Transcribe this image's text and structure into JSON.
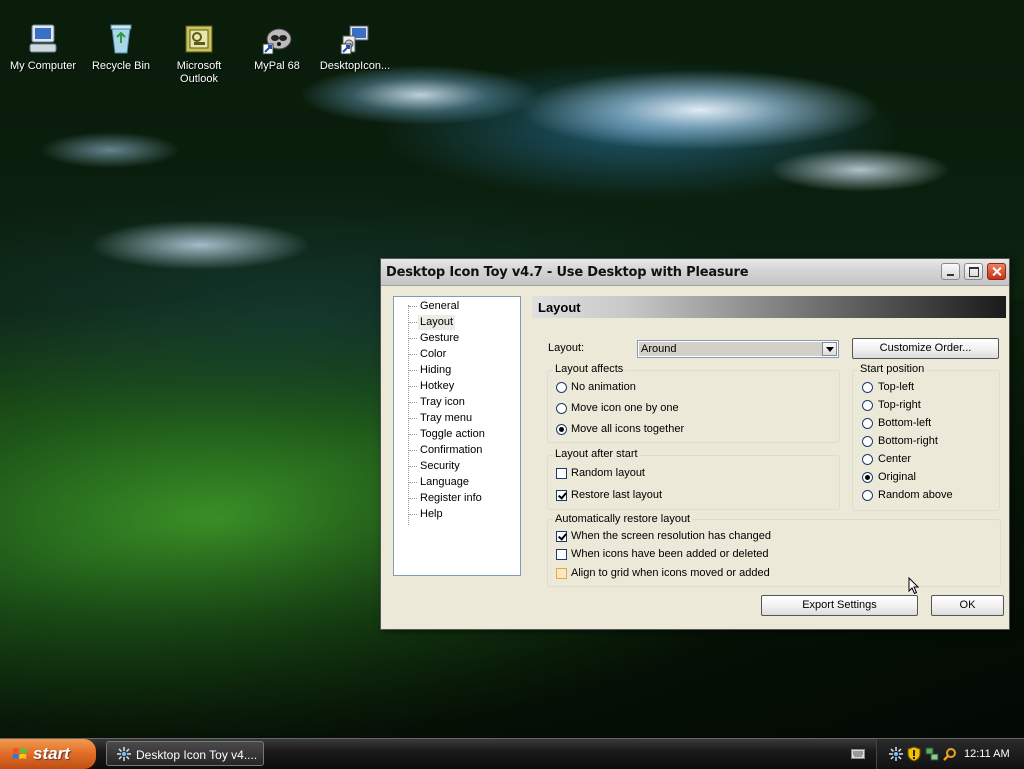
{
  "desktop": {
    "icons": [
      {
        "label": "My Computer",
        "icon": "my-computer-icon"
      },
      {
        "label": "Recycle Bin",
        "icon": "recycle-bin-icon"
      },
      {
        "label": "Microsoft Outlook",
        "icon": "outlook-icon"
      },
      {
        "label": "MyPal 68",
        "icon": "mypal-icon"
      },
      {
        "label": "DesktopIcon...",
        "icon": "installer-icon"
      }
    ]
  },
  "window": {
    "title": "Desktop Icon Toy v4.7 - Use Desktop with Pleasure",
    "tree": [
      "General",
      "Layout",
      "Gesture",
      "Color",
      "Hiding",
      "Hotkey",
      "Tray icon",
      "Tray menu",
      "Toggle action",
      "Confirmation",
      "Security",
      "Language",
      "Register info",
      "Help"
    ],
    "selected_tree_item": "Layout",
    "section_title": "Layout",
    "layout_label": "Layout:",
    "layout_value": "Around",
    "customize_button": "Customize Order...",
    "layout_affects": {
      "title": "Layout affects",
      "options": [
        "No animation",
        "Move icon one by one",
        "Move all icons together"
      ],
      "selected": "Move all icons together"
    },
    "start_position": {
      "title": "Start position",
      "options": [
        "Top-left",
        "Top-right",
        "Bottom-left",
        "Bottom-right",
        "Center",
        "Original",
        "Random above"
      ],
      "selected": "Original"
    },
    "layout_after_start": {
      "title": "Layout after start",
      "options": [
        {
          "label": "Random layout",
          "checked": false
        },
        {
          "label": "Restore last layout",
          "checked": true
        }
      ]
    },
    "auto_restore": {
      "title": "Automatically restore layout",
      "options": [
        {
          "label": "When the screen resolution has changed",
          "checked": true
        },
        {
          "label": "When icons have been added or deleted",
          "checked": false
        },
        {
          "label": "Align to grid when icons moved or added",
          "checked": false
        }
      ]
    },
    "export_button": "Export Settings",
    "ok_button": "OK"
  },
  "taskbar": {
    "start_label": "start",
    "task_label": "Desktop Icon Toy v4....",
    "clock": "12:11 AM"
  },
  "colors": {
    "start_button": "#e2702a",
    "window_face": "#ece9d8",
    "taskbar": "#1a1a1a"
  }
}
